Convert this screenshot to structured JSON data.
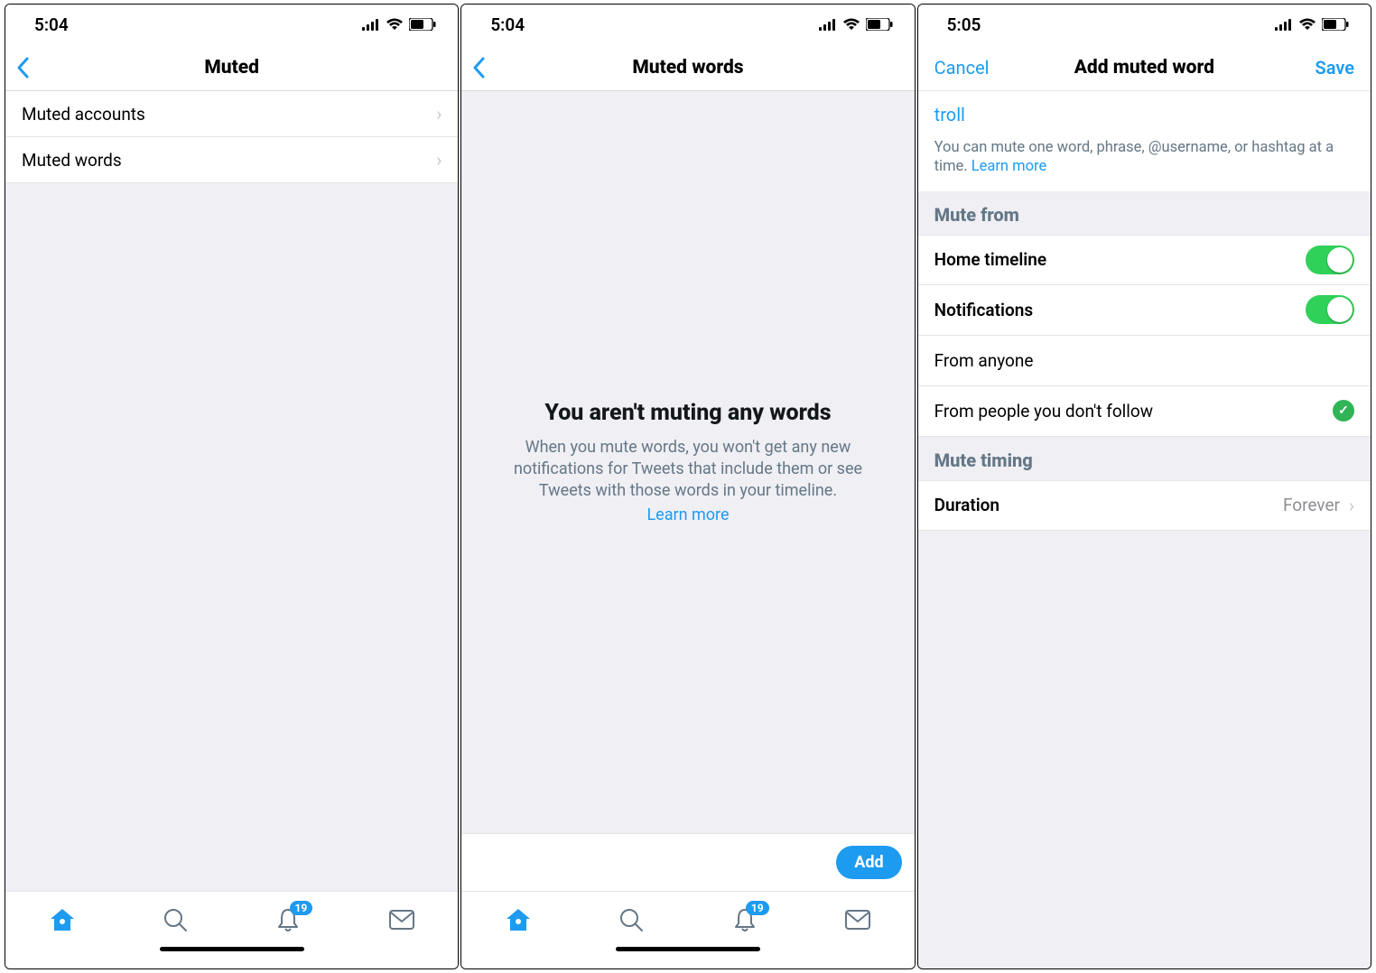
{
  "statusBar": {
    "time1": "5:04",
    "time2": "5:04",
    "time3": "5:05"
  },
  "screen1": {
    "title": "Muted",
    "rows": [
      {
        "label": "Muted accounts"
      },
      {
        "label": "Muted words"
      }
    ],
    "badge": "19"
  },
  "screen2": {
    "title": "Muted words",
    "empty_title": "You aren't muting any words",
    "empty_text": "When you mute words, you won't get any new notifications for Tweets that include them or see Tweets with those words in your timeline.",
    "learn_more": "Learn more",
    "add_label": "Add",
    "badge": "19"
  },
  "screen3": {
    "cancel": "Cancel",
    "title": "Add muted word",
    "save": "Save",
    "word": "troll",
    "help_text": "You can mute one word, phrase, @username, or hashtag at a time.",
    "learn_more": "Learn more",
    "section_mute_from": "Mute from",
    "home_timeline": "Home timeline",
    "notifications": "Notifications",
    "from_anyone": "From anyone",
    "from_people": "From people you don't follow",
    "section_mute_timing": "Mute timing",
    "duration_label": "Duration",
    "duration_value": "Forever"
  }
}
